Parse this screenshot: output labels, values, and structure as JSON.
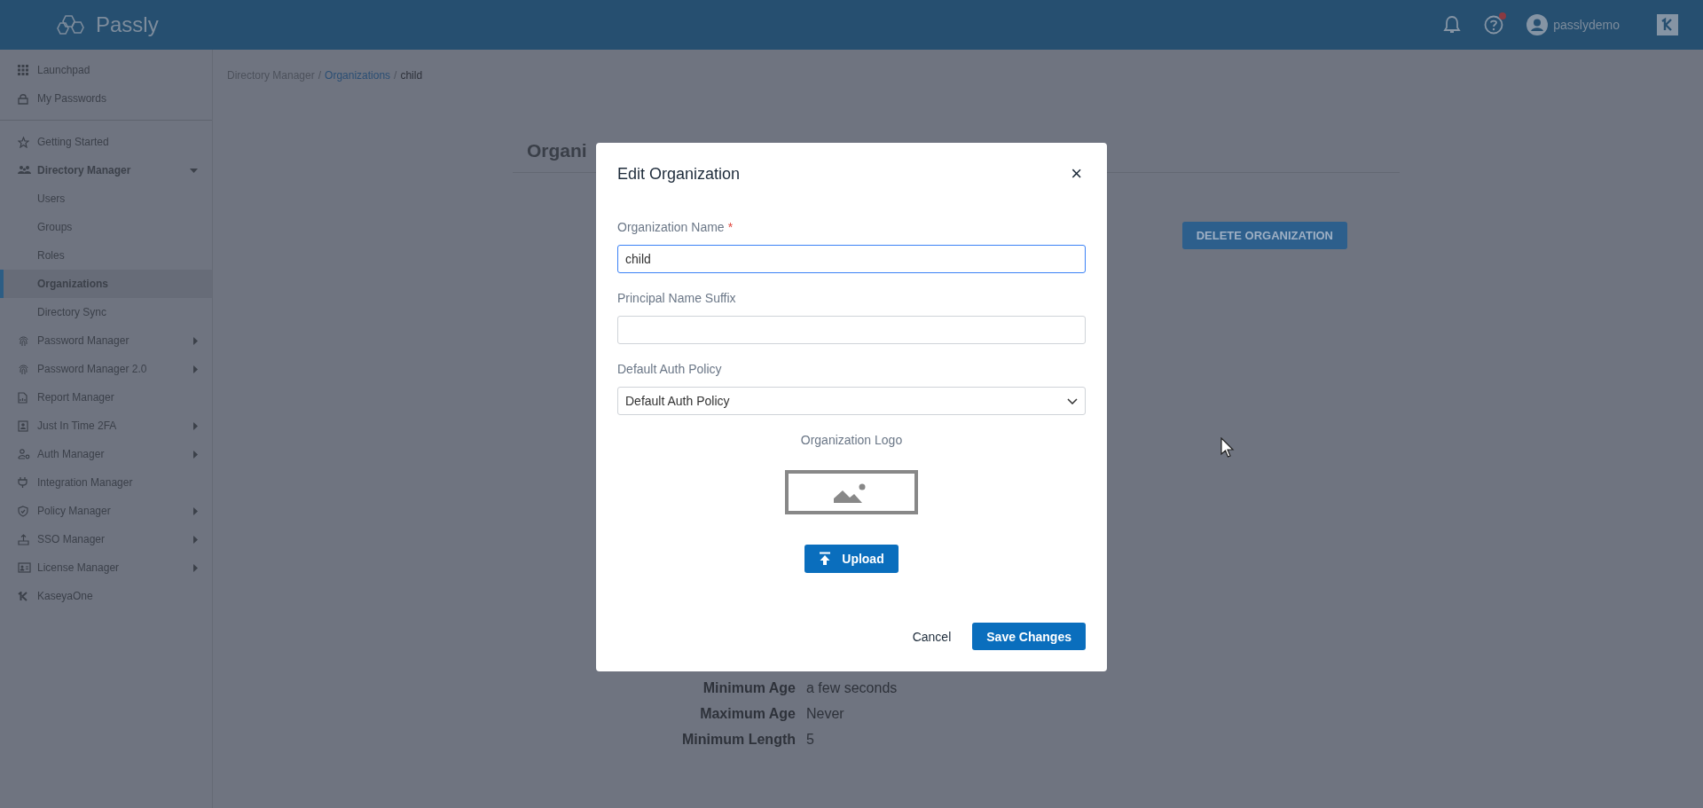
{
  "header": {
    "brand": "Passly",
    "help_badge": true,
    "user": "passlydemo"
  },
  "sidebar": {
    "groups": [
      {
        "items": [
          {
            "label": "Launchpad",
            "selected": false
          },
          {
            "label": "My Passwords",
            "selected": false
          }
        ]
      },
      {
        "items": [
          {
            "label": "Getting Started",
            "selected": false
          },
          {
            "label": "Directory Manager",
            "selected": false,
            "expanded": true,
            "children": [
              {
                "label": "Users",
                "selected": false
              },
              {
                "label": "Groups",
                "selected": false
              },
              {
                "label": "Roles",
                "selected": false
              },
              {
                "label": "Organizations",
                "selected": true
              },
              {
                "label": "Directory Sync",
                "selected": false
              }
            ]
          },
          {
            "label": "Password Manager",
            "selected": false,
            "expanded": false
          },
          {
            "label": "Password Manager 2.0",
            "selected": false,
            "expanded": false
          },
          {
            "label": "Report Manager",
            "selected": false
          },
          {
            "label": "Just In Time 2FA",
            "selected": false,
            "expanded": false
          },
          {
            "label": "Auth Manager",
            "selected": false,
            "expanded": false
          },
          {
            "label": "Integration Manager",
            "selected": false
          },
          {
            "label": "Policy Manager",
            "selected": false,
            "expanded": false
          },
          {
            "label": "SSO Manager",
            "selected": false,
            "expanded": false
          },
          {
            "label": "License Manager",
            "selected": false,
            "expanded": false
          },
          {
            "label": "KaseyaOne",
            "selected": false
          }
        ]
      }
    ]
  },
  "breadcrumb": {
    "separator": "/",
    "items": [
      {
        "label": "Directory Manager",
        "link": false
      },
      {
        "label": "Organizations",
        "link": true
      },
      {
        "label": "child",
        "link": false
      }
    ]
  },
  "page": {
    "title": "Organi",
    "delete_button": "DELETE ORGANIZATION",
    "details": [
      {
        "label": "Minimum Age",
        "value": "a few seconds"
      },
      {
        "label": "Maximum Age",
        "value": "Never"
      },
      {
        "label": "Minimum Length",
        "value": "5"
      }
    ]
  },
  "modal": {
    "title": "Edit Organization",
    "close": "×",
    "fields": [
      {
        "kind": "text",
        "label": "Organization Name",
        "required_mark": "*",
        "focused": true,
        "value": "child"
      },
      {
        "kind": "text",
        "label": "Principal Name Suffix",
        "focused": false
      },
      {
        "kind": "select",
        "label": "Default Auth Policy",
        "focused": false,
        "value": "Default Auth Policy"
      }
    ],
    "logo": {
      "label": "Organization Logo",
      "button": "Upload"
    },
    "actions": [
      {
        "kind": "text",
        "label": "Cancel"
      },
      {
        "kind": "primary",
        "label": "Save Changes"
      }
    ]
  }
}
